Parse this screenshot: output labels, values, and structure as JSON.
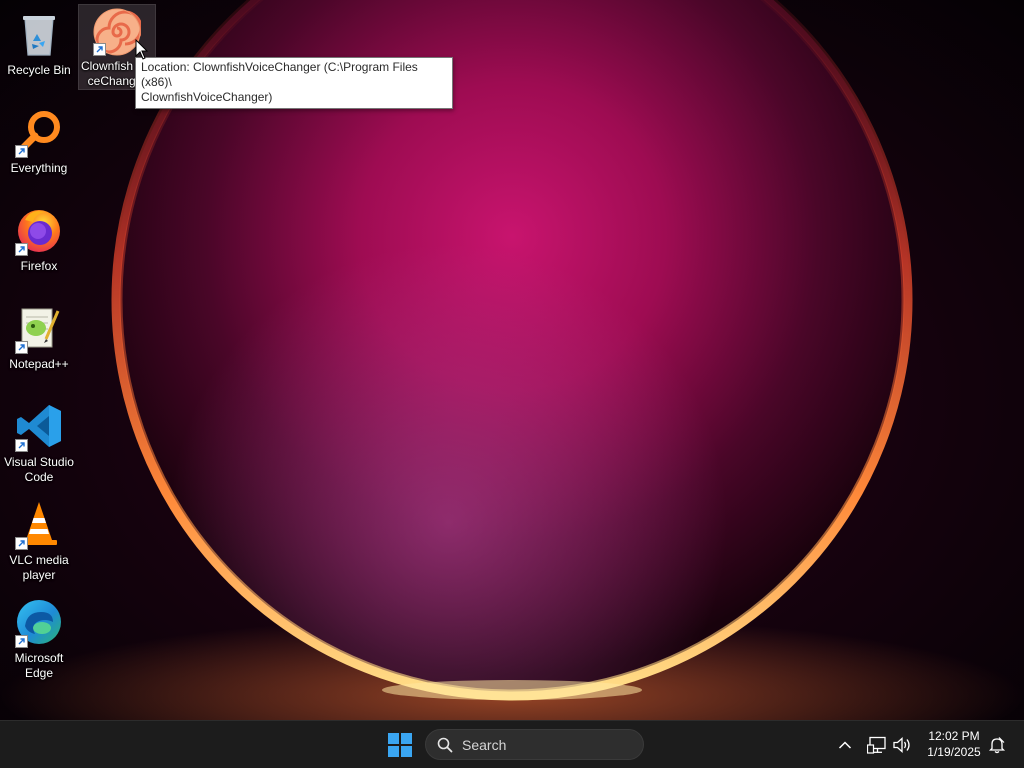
{
  "desktop": {
    "icons": [
      {
        "label": "Recycle Bin",
        "icon": "recycle-bin-icon"
      },
      {
        "label": "Clownfish Voi\nceChanger",
        "icon": "clownfish-icon",
        "selected": true
      },
      {
        "label": "Everything",
        "icon": "everything-search-icon"
      },
      {
        "label": "Firefox",
        "icon": "firefox-icon"
      },
      {
        "label": "Notepad++",
        "icon": "notepadpp-icon"
      },
      {
        "label": "Visual Studio\nCode",
        "icon": "vscode-icon"
      },
      {
        "label": "VLC media\nplayer",
        "icon": "vlc-icon"
      },
      {
        "label": "Microsoft\nEdge",
        "icon": "edge-icon"
      }
    ],
    "tooltip": "Location: ClownfishVoiceChanger (C:\\Program Files (x86)\\\nClownfishVoiceChanger)"
  },
  "taskbar": {
    "start_icon": "windows-logo-icon",
    "search_placeholder": "Search",
    "tray": {
      "overflow_icon": "chevron-up-icon",
      "network_icon": "network-icon",
      "volume_icon": "volume-icon",
      "notification_icon": "notification-bell-icon"
    },
    "clock": {
      "time": "12:02 PM",
      "date": "1/19/2025"
    }
  },
  "colors": {
    "taskbar_bg": "#1c1c1c",
    "start_blue": "#3aa6f2",
    "wallpaper_glow": "#c8146e",
    "wallpaper_rim": "#ffb347"
  }
}
